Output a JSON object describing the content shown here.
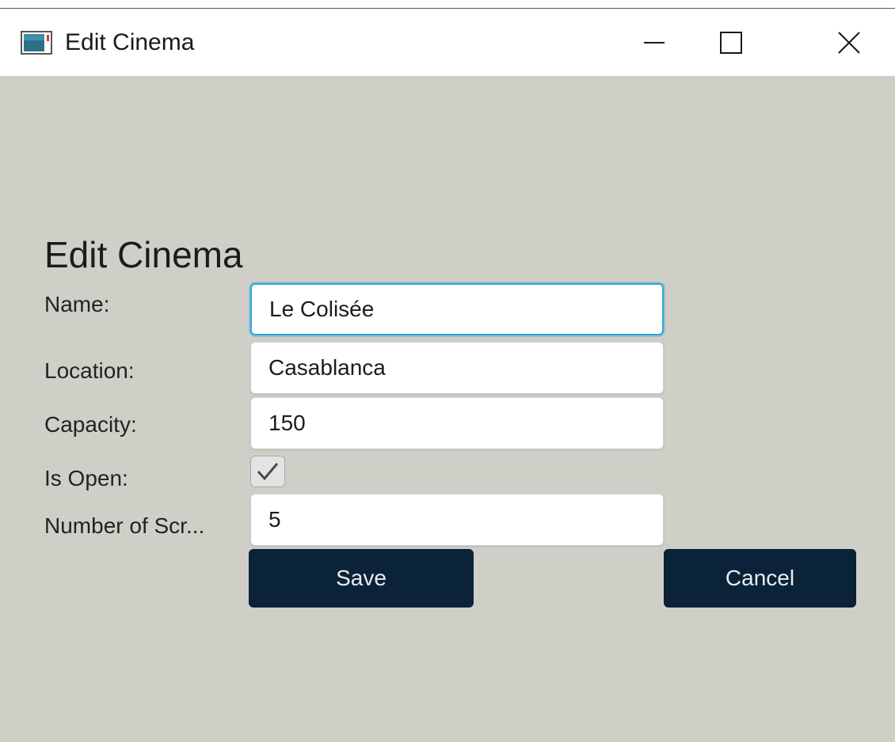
{
  "window": {
    "title": "Edit Cinema"
  },
  "icons": {
    "app": "app-window-icon",
    "minimize": "minimize-icon",
    "maximize": "maximize-icon",
    "close": "close-icon",
    "checkmark": "checkmark-icon"
  },
  "form": {
    "title": "Edit Cinema",
    "fields": {
      "name": {
        "label": "Name:",
        "value": "Le Colisée"
      },
      "location": {
        "label": "Location:",
        "value": "Casablanca"
      },
      "capacity": {
        "label": "Capacity:",
        "value": "150"
      },
      "is_open": {
        "label": "Is Open:",
        "checked": true
      },
      "screens": {
        "label": "Number of Scr...",
        "value": "5"
      }
    },
    "buttons": {
      "save": "Save",
      "cancel": "Cancel"
    }
  },
  "colors": {
    "background": "#d0cfc7",
    "button": "#0b2338",
    "focus_border": "#2aa6d8"
  }
}
